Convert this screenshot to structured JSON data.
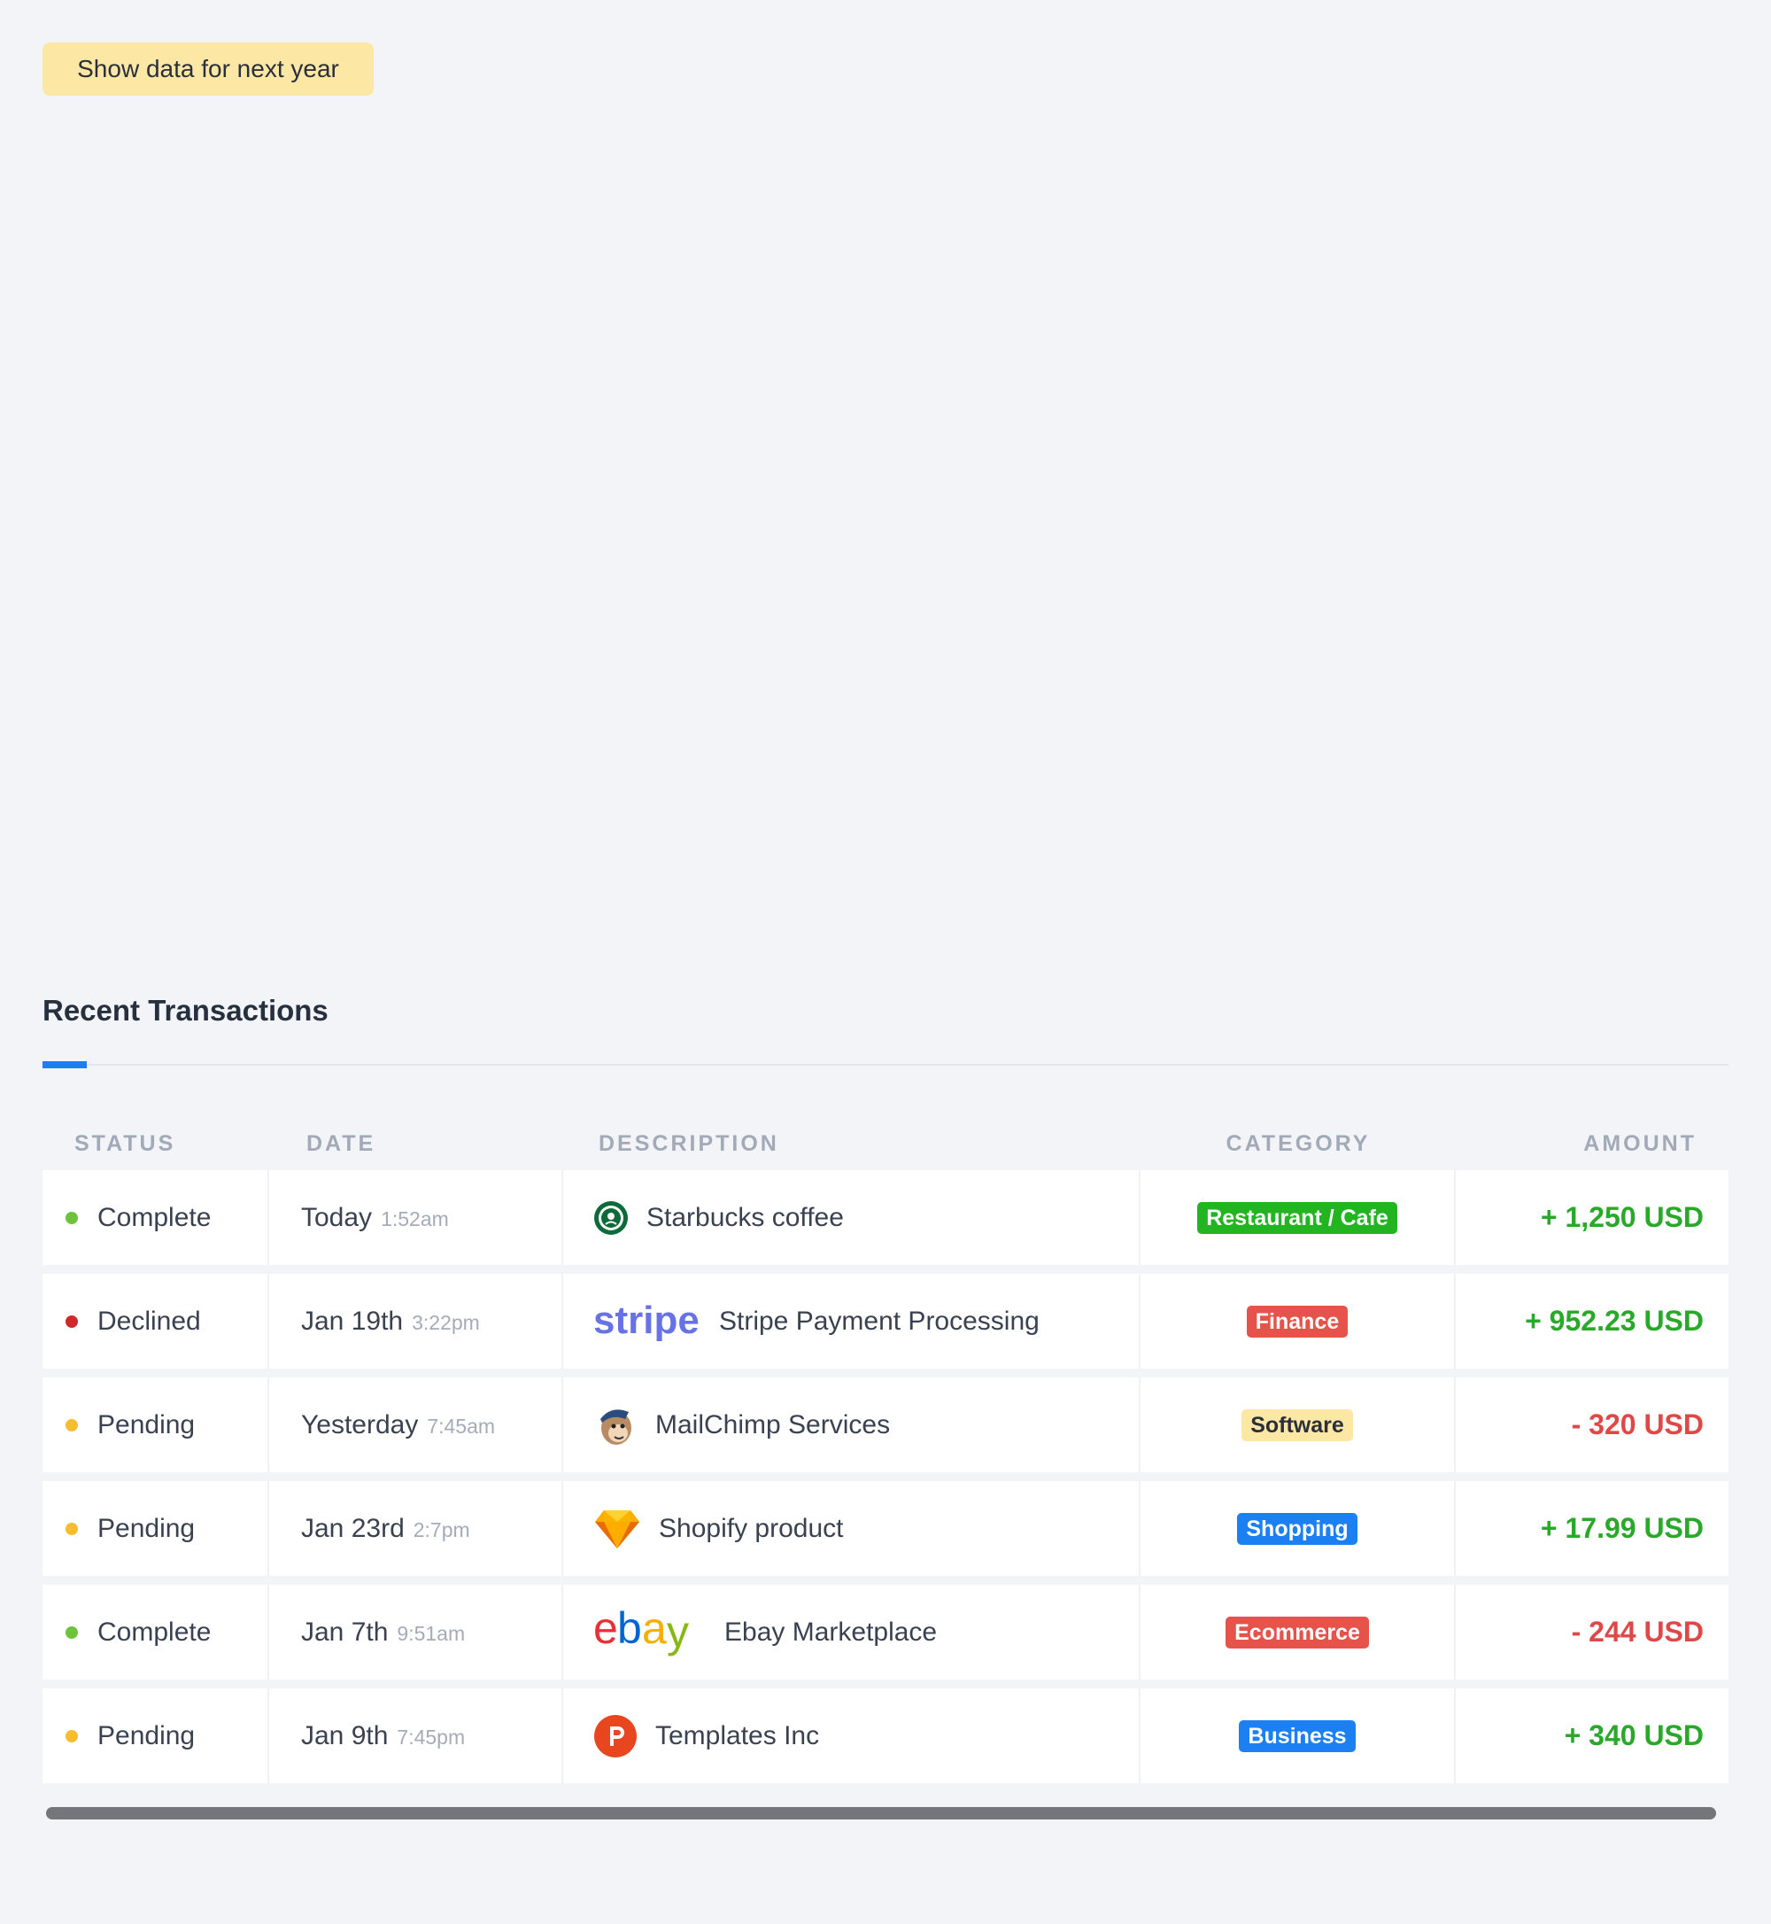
{
  "actions": {
    "next_year_label": "Show data for next year"
  },
  "transactions": {
    "title": "Recent Transactions",
    "headers": {
      "status": "STATUS",
      "date": "DATE",
      "description": "DESCRIPTION",
      "category": "CATEGORY",
      "amount": "AMOUNT"
    },
    "rows": [
      {
        "status": "Complete",
        "status_color": "#6dc43a",
        "date": "Today",
        "time": "1:52am",
        "description": "Starbucks coffee",
        "logo": "starbucks-logo",
        "category": "Restaurant / Cafe",
        "category_bg": "#22b521",
        "category_fg": "#ffffff",
        "amount": "+ 1,250 USD",
        "amount_color": "#2aa82a"
      },
      {
        "status": "Declined",
        "status_color": "#cf2a2a",
        "date": "Jan 19th",
        "time": "3:22pm",
        "description": "Stripe Payment Processing",
        "logo": "stripe-logo",
        "category": "Finance",
        "category_bg": "#e5534b",
        "category_fg": "#ffffff",
        "amount": "+ 952.23 USD",
        "amount_color": "#2aa82a"
      },
      {
        "status": "Pending",
        "status_color": "#f7bd2f",
        "date": "Yesterday",
        "time": "7:45am",
        "description": "MailChimp Services",
        "logo": "mailchimp-logo",
        "category": "Software",
        "category_bg": "#fde7a4",
        "category_fg": "#2a2f3a",
        "amount": "- 320 USD",
        "amount_color": "#e04848"
      },
      {
        "status": "Pending",
        "status_color": "#f7bd2f",
        "date": "Jan 23rd",
        "time": "2:7pm",
        "description": "Shopify product",
        "logo": "sketch-logo",
        "category": "Shopping",
        "category_bg": "#1c7ff2",
        "category_fg": "#ffffff",
        "amount": "+ 17.99 USD",
        "amount_color": "#2aa82a"
      },
      {
        "status": "Complete",
        "status_color": "#6dc43a",
        "date": "Jan 7th",
        "time": "9:51am",
        "description": "Ebay Marketplace",
        "logo": "ebay-logo",
        "category": "Ecommerce",
        "category_bg": "#e5534b",
        "category_fg": "#ffffff",
        "amount": "- 244 USD",
        "amount_color": "#e04848"
      },
      {
        "status": "Pending",
        "status_color": "#f7bd2f",
        "date": "Jan 9th",
        "time": "7:45pm",
        "description": "Templates Inc",
        "logo": "producthunt-logo",
        "category": "Business",
        "category_bg": "#1c7ff2",
        "category_fg": "#ffffff",
        "amount": "+ 340 USD",
        "amount_color": "#2aa82a"
      }
    ]
  }
}
